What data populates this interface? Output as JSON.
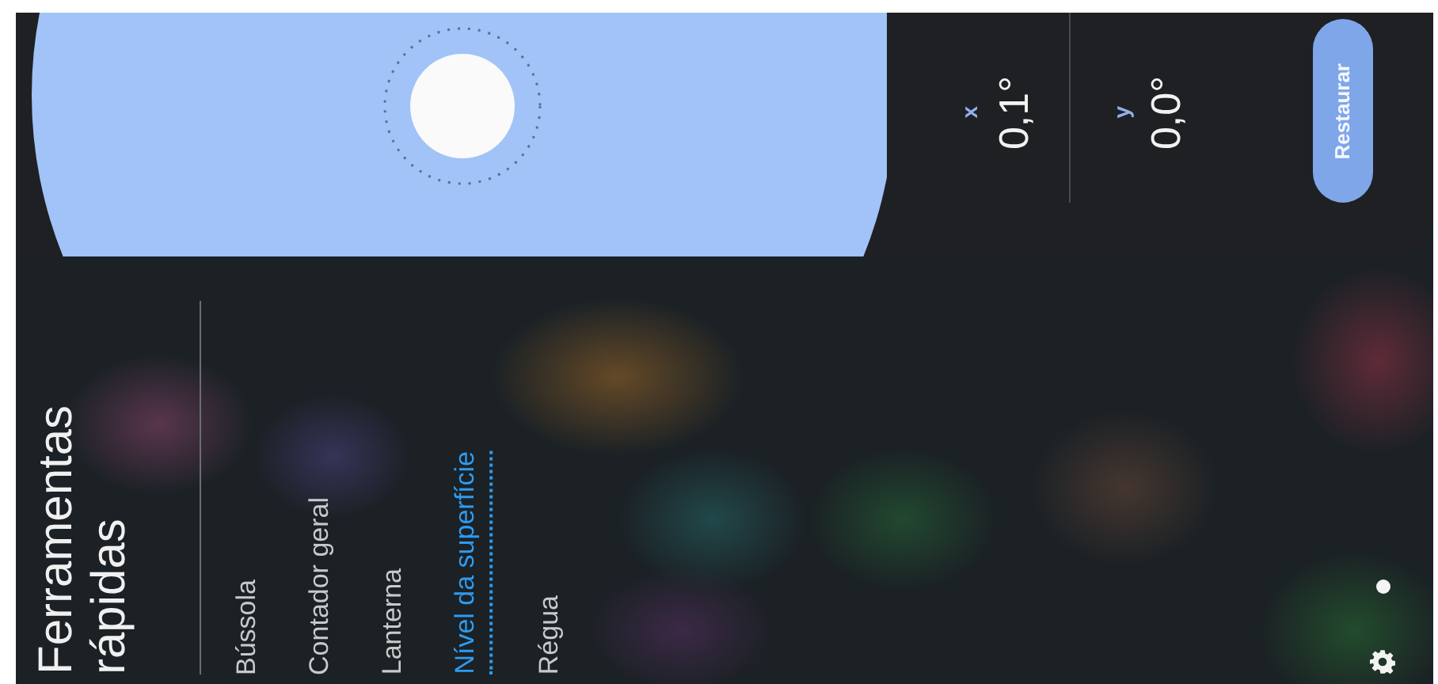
{
  "level_panel": {
    "readings": [
      {
        "axis": "x",
        "value": "0,1°"
      },
      {
        "axis": "y",
        "value": "0,0°"
      }
    ],
    "reset_button": "Restaurar"
  },
  "menu": {
    "title": "Ferramentas rápidas",
    "items": [
      {
        "label": "Bússola",
        "selected": false
      },
      {
        "label": "Contador geral",
        "selected": false
      },
      {
        "label": "Lanterna",
        "selected": false
      },
      {
        "label": "Nível da superfície",
        "selected": true
      },
      {
        "label": "Régua",
        "selected": false
      }
    ]
  }
}
